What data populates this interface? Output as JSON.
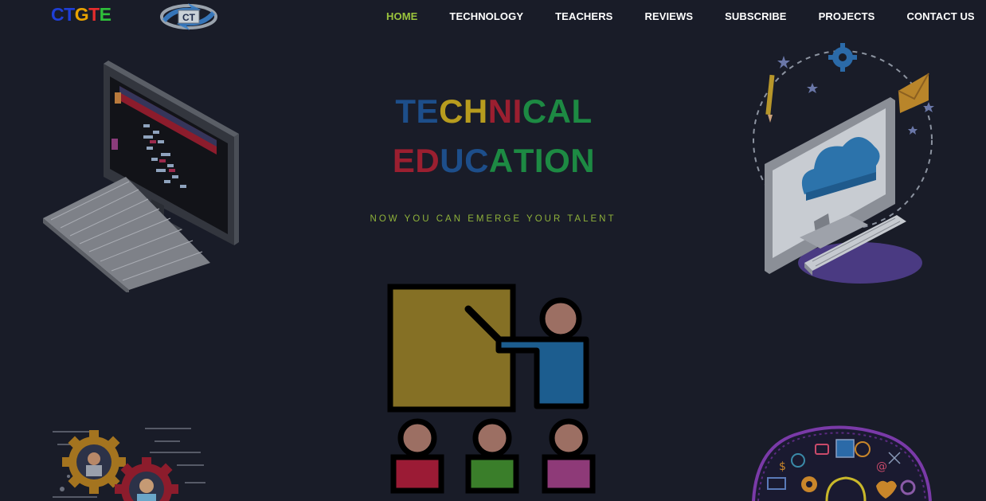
{
  "brand": {
    "letters": [
      "C",
      "T",
      "G",
      "T",
      "E"
    ],
    "colors": [
      "#1f3fd6",
      "#1f3fd6",
      "#e8a200",
      "#e52d2d",
      "#2fbf3a"
    ],
    "emblem_text": "CT"
  },
  "nav": {
    "items": [
      "HOME",
      "TECHNOLOGY",
      "TEACHERS",
      "REVIEWS",
      "SUBSCRIBE",
      "PROJECTS",
      "CONTACT US"
    ],
    "active": "HOME",
    "active_color": "#9bc53d"
  },
  "hero": {
    "line1": [
      "T",
      "E",
      "C",
      "H",
      "N",
      "I",
      "C",
      "A",
      "L"
    ],
    "line1_colors": [
      "#1d4e8a",
      "#1d4e8a",
      "#b79c1e",
      "#b79c1e",
      "#9b1f30",
      "#9b1f30",
      "#1d8a43",
      "#1d8a43",
      "#1d8a43"
    ],
    "line2": [
      "E",
      "D",
      "U",
      "C",
      "A",
      "T",
      "I",
      "O",
      "N"
    ],
    "line2_colors": [
      "#9b1f30",
      "#9b1f30",
      "#1d4e8a",
      "#1d4e8a",
      "#1d8a43",
      "#1d8a43",
      "#1d8a43",
      "#1d8a43",
      "#1d8a43"
    ],
    "tagline": "NOW YOU CAN EMERGE YOUR TALENT"
  },
  "icons": [
    "computer-illustration-icon",
    "cloud-computer-illustration-icon",
    "classroom-teacher-icon",
    "gear-team-illustration-icon",
    "brain-ideas-illustration-icon"
  ]
}
